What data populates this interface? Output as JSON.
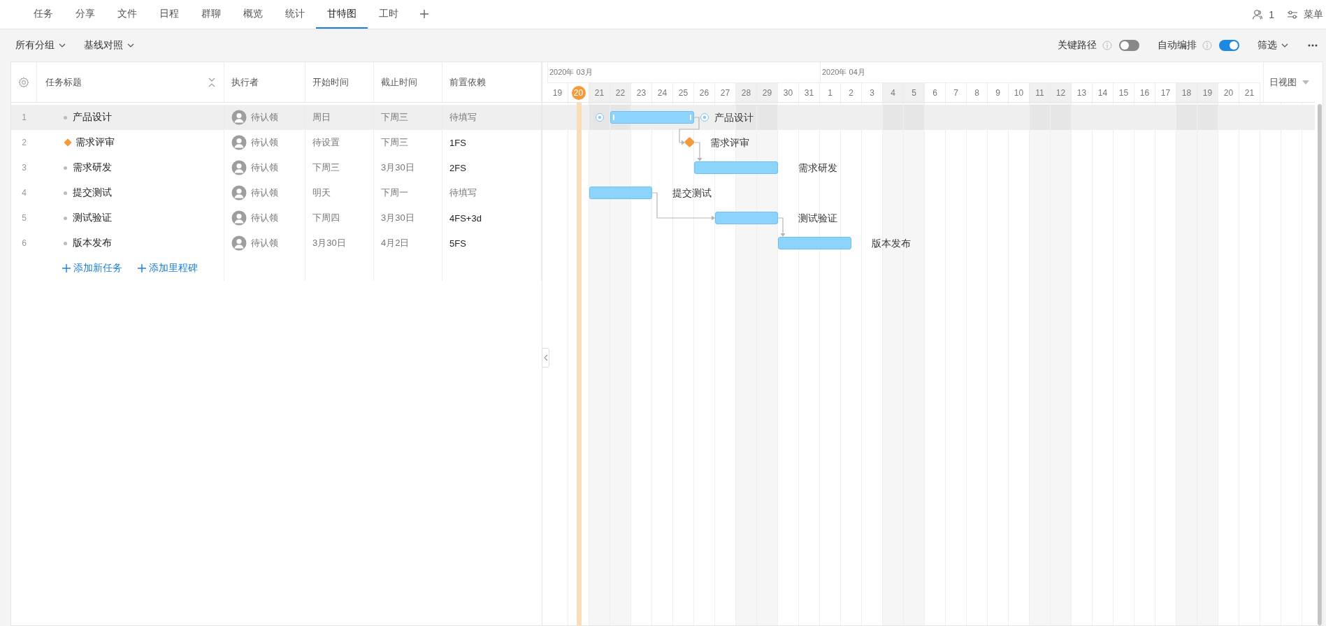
{
  "tabs": [
    {
      "label": "任务",
      "selected": false
    },
    {
      "label": "分享",
      "selected": false
    },
    {
      "label": "文件",
      "selected": false
    },
    {
      "label": "日程",
      "selected": false
    },
    {
      "label": "群聊",
      "selected": false
    },
    {
      "label": "概览",
      "selected": false
    },
    {
      "label": "统计",
      "selected": false
    },
    {
      "label": "甘特图",
      "selected": true
    },
    {
      "label": "工时",
      "selected": false
    }
  ],
  "header_right": {
    "member_count": "1",
    "menu_label": "菜单"
  },
  "toolbar": {
    "dropdowns": [
      "所有分组",
      "基线对照"
    ],
    "toggles": [
      {
        "label": "关键路径",
        "on": false
      },
      {
        "label": "自动编排",
        "on": true
      }
    ],
    "filter": "筛选"
  },
  "table": {
    "columns": [
      "任务标题",
      "执行者",
      "开始时间",
      "截止时间",
      "前置依赖"
    ],
    "rows": [
      {
        "index": "1",
        "kind": "task",
        "title": "产品设计",
        "assignee": "待认领",
        "start": "周日",
        "due": "下周三",
        "dependency": "待填写",
        "dependency_set": false,
        "highlighted": true
      },
      {
        "index": "2",
        "kind": "milestone",
        "title": "需求评审",
        "assignee": "待认领",
        "start": "待设置",
        "due": "下周三",
        "dependency": "1FS",
        "dependency_set": true,
        "highlighted": false
      },
      {
        "index": "3",
        "kind": "task",
        "title": "需求研发",
        "assignee": "待认领",
        "start": "下周三",
        "due": "3月30日",
        "dependency": "2FS",
        "dependency_set": true,
        "highlighted": false
      },
      {
        "index": "4",
        "kind": "task",
        "title": "提交测试",
        "assignee": "待认领",
        "start": "明天",
        "due": "下周一",
        "dependency": "待填写",
        "dependency_set": false,
        "highlighted": false
      },
      {
        "index": "5",
        "kind": "task",
        "title": "测试验证",
        "assignee": "待认领",
        "start": "下周四",
        "due": "3月30日",
        "dependency": "4FS+3d",
        "dependency_set": true,
        "highlighted": false
      },
      {
        "index": "6",
        "kind": "task",
        "title": "版本发布",
        "assignee": "待认领",
        "start": "3月30日",
        "due": "4月2日",
        "dependency": "5FS",
        "dependency_set": true,
        "highlighted": false
      }
    ],
    "actions": [
      "添加新任务",
      "添加里程碑"
    ]
  },
  "gantt": {
    "view": "日视图",
    "months": [
      {
        "label": "2020年 03月",
        "days": [
          {
            "label": "19",
            "weekend": false,
            "today": false
          },
          {
            "label": "20",
            "weekend": false,
            "today": true
          },
          {
            "label": "21",
            "weekend": true,
            "today": false
          },
          {
            "label": "22",
            "weekend": true,
            "today": false
          },
          {
            "label": "23",
            "weekend": false,
            "today": false
          },
          {
            "label": "24",
            "weekend": false,
            "today": false
          },
          {
            "label": "25",
            "weekend": false,
            "today": false
          },
          {
            "label": "26",
            "weekend": false,
            "today": false
          },
          {
            "label": "27",
            "weekend": false,
            "today": false
          },
          {
            "label": "28",
            "weekend": true,
            "today": false
          },
          {
            "label": "29",
            "weekend": true,
            "today": false
          },
          {
            "label": "30",
            "weekend": false,
            "today": false
          },
          {
            "label": "31",
            "weekend": false,
            "today": false
          }
        ]
      },
      {
        "label": "2020年 04月",
        "days": [
          {
            "label": "1",
            "weekend": false,
            "today": false
          },
          {
            "label": "2",
            "weekend": false,
            "today": false
          },
          {
            "label": "3",
            "weekend": false,
            "today": false
          },
          {
            "label": "4",
            "weekend": true,
            "today": false
          },
          {
            "label": "5",
            "weekend": true,
            "today": false
          },
          {
            "label": "6",
            "weekend": false,
            "today": false
          },
          {
            "label": "7",
            "weekend": false,
            "today": false
          },
          {
            "label": "8",
            "weekend": false,
            "today": false
          },
          {
            "label": "9",
            "weekend": false,
            "today": false
          },
          {
            "label": "10",
            "weekend": false,
            "today": false
          },
          {
            "label": "11",
            "weekend": true,
            "today": false
          },
          {
            "label": "12",
            "weekend": true,
            "today": false
          },
          {
            "label": "13",
            "weekend": false,
            "today": false
          },
          {
            "label": "14",
            "weekend": false,
            "today": false
          },
          {
            "label": "15",
            "weekend": false,
            "today": false
          },
          {
            "label": "16",
            "weekend": false,
            "today": false
          },
          {
            "label": "17",
            "weekend": false,
            "today": false
          },
          {
            "label": "18",
            "weekend": true,
            "today": false
          },
          {
            "label": "19",
            "weekend": true,
            "today": false
          },
          {
            "label": "20",
            "weekend": false,
            "today": false
          },
          {
            "label": "21",
            "weekend": false,
            "today": false
          }
        ]
      }
    ],
    "bars": [
      {
        "label": "产品设计"
      },
      {
        "label": "需求评审"
      },
      {
        "label": "需求研发"
      },
      {
        "label": "提交测试"
      },
      {
        "label": "测试验证"
      },
      {
        "label": "版本发布"
      }
    ]
  }
}
